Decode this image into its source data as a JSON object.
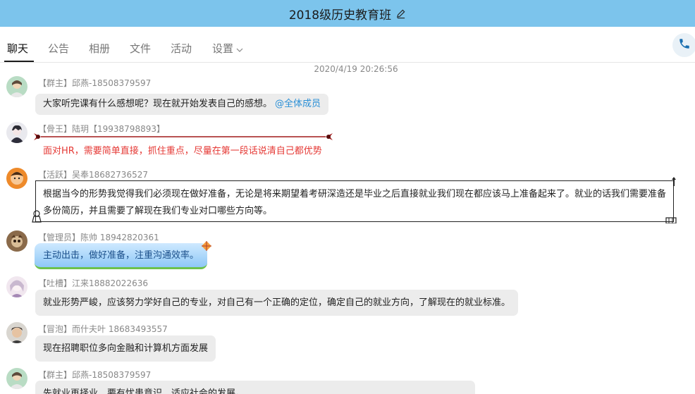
{
  "window": {
    "title": "2018级历史教育班"
  },
  "tabs": [
    {
      "label": "聊天"
    },
    {
      "label": "公告"
    },
    {
      "label": "相册"
    },
    {
      "label": "文件"
    },
    {
      "label": "活动"
    },
    {
      "label": "设置"
    }
  ],
  "chat": {
    "timestamp": "2020/4/19 20:26:56",
    "messages": [
      {
        "sender": "【群主】邱燕-18508379597",
        "text": "大家听完课有什么感想呢？现在就开始发表自己的感想。",
        "mention": "@全体成员"
      },
      {
        "sender": "【骨王】陆玥【19938798893】",
        "text": "面对HR，需要简单直接，抓住重点，尽量在第一段话说清自己都优势"
      },
      {
        "sender": "【活跃】吴奉18682736527",
        "text_line1": "根据当今的形势我觉得我们必须现在做好准备，无论是将来期望着考研深造还是毕业之后直接就业我们现在都应该马上准备起来了。就业的话我们需要准备",
        "text_line2": "多份简历，并且需要了解现在我们专业对口哪些方向等。"
      },
      {
        "sender": "【管理员】陈帅 18942820361",
        "text": "主动出击，做好准备，注重沟通效率。"
      },
      {
        "sender": "【吐槽】江来18882022636",
        "text": "就业形势严峻，应该努力学好自己的专业，对自己有一个正确的定位，确定自己的就业方向，了解现在的就业标准。"
      },
      {
        "sender": "【冒泡】而什夫叶 18683493557",
        "text": "现在招聘职位多向金融和计算机方面发展"
      },
      {
        "sender": "【群主】邱燕-18508379597",
        "text": "先就业再择业，要有忧患意识，适应社会的发展。"
      }
    ]
  },
  "icons": {
    "edit": "edit-icon",
    "dropdown": "chevron-down-icon",
    "phone": "phone-icon"
  },
  "colors": {
    "titlebar": "#7cc4ec",
    "mention": "#2a8fd6",
    "highlight_red": "#e53935",
    "phone": "#1a6fb0"
  }
}
